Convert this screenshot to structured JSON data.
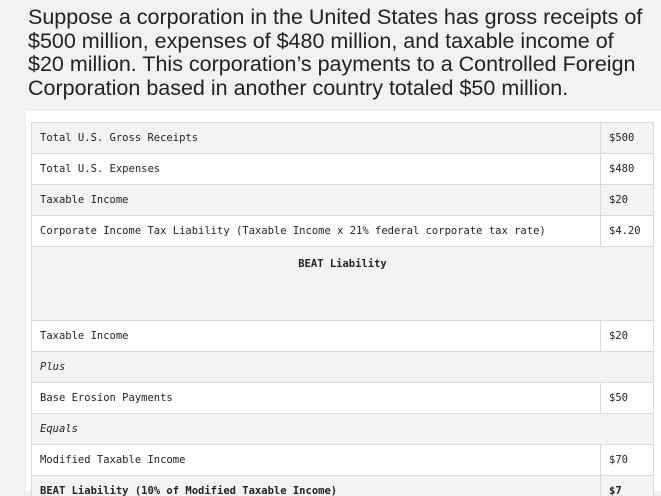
{
  "intro": "Suppose a corporation in the United States has gross receipts of $500 million, expenses of $480 million, and taxable income of $20 million. This corporation’s payments to a Controlled Foreign Corporation based in another country totaled $50 million.",
  "table": {
    "rows": [
      {
        "label": "Total U.S. Gross Receipts",
        "value": "$500"
      },
      {
        "label": "Total U.S. Expenses",
        "value": "$480"
      },
      {
        "label": "Taxable Income",
        "value": "$20"
      },
      {
        "label": "Corporate Income Tax Liability (Taxable Income x 21% federal corporate tax rate)",
        "value": "$4.20"
      }
    ],
    "section_heading": "BEAT Liability",
    "beat_rows": [
      {
        "label": "Taxable Income",
        "value": "$20"
      },
      {
        "label": "Plus"
      },
      {
        "label": "Base Erosion Payments",
        "value": "$50"
      },
      {
        "label": "Equals"
      },
      {
        "label": "Modified Taxable Income",
        "value": "$70"
      },
      {
        "label": "BEAT Liability (10% of Modified Taxable Income)",
        "value": "$7"
      }
    ]
  }
}
